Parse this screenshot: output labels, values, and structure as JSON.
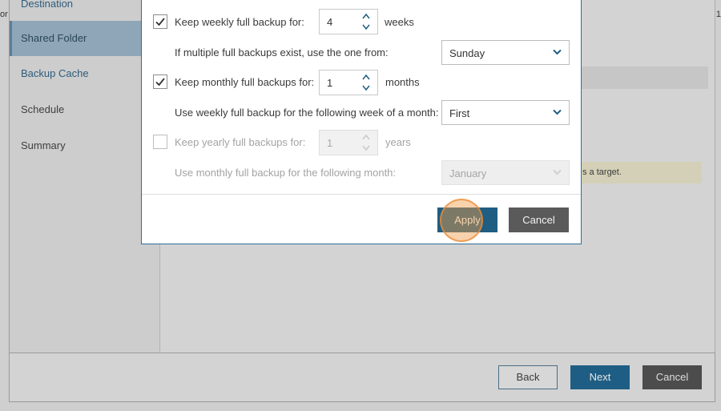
{
  "background": {
    "sidebar": {
      "items": [
        {
          "label": "Destination",
          "state": "link"
        },
        {
          "label": "Shared Folder",
          "state": "active"
        },
        {
          "label": "Backup Cache",
          "state": "link"
        },
        {
          "label": "Schedule",
          "state": "normal"
        },
        {
          "label": "Summary",
          "state": "normal"
        }
      ]
    },
    "edge_left_text": "or",
    "edge_right_text": "1",
    "warning_fragment": "s a target.",
    "buttons": {
      "back": "Back",
      "next": "Next",
      "cancel": "Cancel"
    }
  },
  "dialog": {
    "weekly": {
      "checked": true,
      "label": "Keep weekly full backup for:",
      "value": "4",
      "unit": "weeks",
      "sub_label": "If multiple full backups exist, use the one from:",
      "sub_value": "Sunday"
    },
    "monthly": {
      "checked": true,
      "label": "Keep monthly full backups for:",
      "value": "1",
      "unit": "months",
      "sub_label": "Use weekly full backup for the following week of a month:",
      "sub_value": "First"
    },
    "yearly": {
      "checked": false,
      "disabled": true,
      "label": "Keep yearly full backups for:",
      "value": "1",
      "unit": "years",
      "sub_label": "Use monthly full backup for the following month:",
      "sub_value": "January"
    },
    "buttons": {
      "apply": "Apply",
      "cancel": "Cancel"
    }
  },
  "colors": {
    "accent": "#1f5d82",
    "checkbox": "#333333",
    "click_highlight": "#f09b46"
  }
}
